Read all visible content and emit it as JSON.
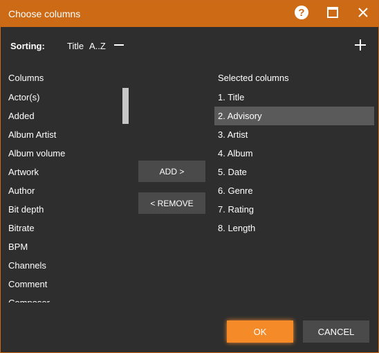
{
  "window": {
    "title": "Choose columns"
  },
  "sorting": {
    "label": "Sorting:",
    "field": "Title",
    "order": "A..Z"
  },
  "columns": {
    "header": "Columns",
    "items": [
      "Actor(s)",
      "Added",
      "Album Artist",
      "Album volume",
      "Artwork",
      "Author",
      "Bit depth",
      "Bitrate",
      "BPM",
      "Channels",
      "Comment",
      "Composer"
    ]
  },
  "buttons": {
    "add": "ADD >",
    "remove": "< REMOVE",
    "ok": "OK",
    "cancel": "CANCEL"
  },
  "selected": {
    "header": "Selected columns",
    "items": [
      "1.  Title",
      "2.  Advisory",
      "3.  Artist",
      "4.  Album",
      "5.  Date",
      "6.  Genre",
      "7.  Rating",
      "8.  Length"
    ]
  },
  "colors": {
    "titlebar": "#cc6a16",
    "accent": "#f58a29",
    "background": "#2e2e2e",
    "selected_row": "#5a5a5a"
  }
}
